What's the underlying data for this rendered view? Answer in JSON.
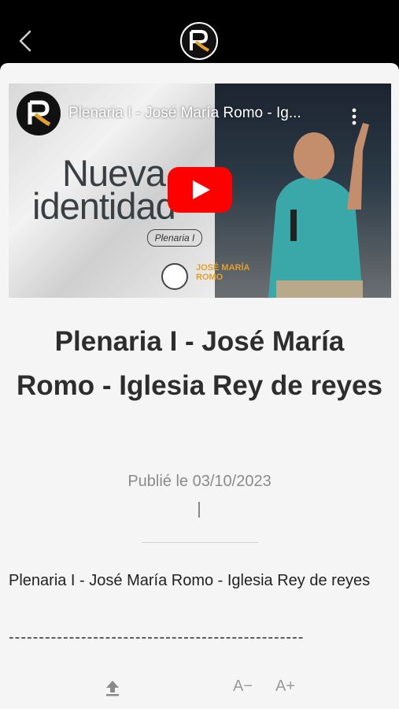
{
  "header": {
    "back_icon": "chevron-left-icon",
    "logo_icon": "church-logo-icon"
  },
  "video": {
    "title": "Plenaria I - José María Romo - Ig...",
    "thumbnail_headline_1": "Nueva",
    "thumbnail_headline_2": "identidad",
    "thumbnail_badge": "Plenaria I",
    "thumbnail_speaker": "JOSÉ MARÍA ROMO",
    "play_icon": "youtube-play-icon",
    "more_icon": "more-vertical-icon",
    "accent": "#ff0000"
  },
  "article": {
    "title": "Plenaria I - José María Romo - Iglesia Rey de reyes",
    "date": "Publié le 03/10/2023",
    "body": "Plenaria I - José María Romo - Iglesia Rey de reyes",
    "separator": "-------------------------------------------------"
  },
  "toolbar": {
    "share_icon": "share-upload-icon",
    "font_decrease": "A−",
    "font_increase": "A+"
  }
}
